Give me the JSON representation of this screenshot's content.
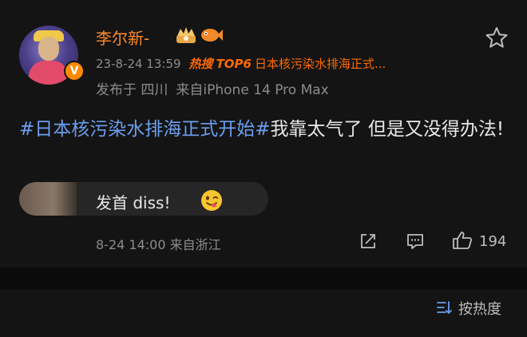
{
  "post": {
    "username": "李尔新-",
    "verified_badge": "V",
    "timestamp": "23-8-24 13:59",
    "hot_badge": "热搜",
    "hot_rank": "TOP6",
    "hot_topic": "日本核污染水排海正式...",
    "published_from": "发布于 四川",
    "device": "来自iPhone 14 Pro Max",
    "content": {
      "hashtag": "#日本核污染水排海正式开始#",
      "text": "我靠太气了 但是又没得办法!"
    },
    "comment": {
      "text": "发首 diss!"
    },
    "footer": {
      "time_location": "8-24 14:00 来自浙江",
      "like_count": "194"
    }
  },
  "sortbar": {
    "label": "按热度"
  },
  "icons": {
    "star": "star-outline-icon",
    "share": "share-icon",
    "comment": "comment-icon",
    "like": "thumbs-up-icon",
    "sort": "sort-icon",
    "emoji": "yummy-face-emoji-icon"
  },
  "colors": {
    "background": "#121212",
    "username": "#ff8a2a",
    "hot": "#ff6a00",
    "hashtag": "#6b9ef0",
    "secondary_text": "#8c8c8c"
  }
}
